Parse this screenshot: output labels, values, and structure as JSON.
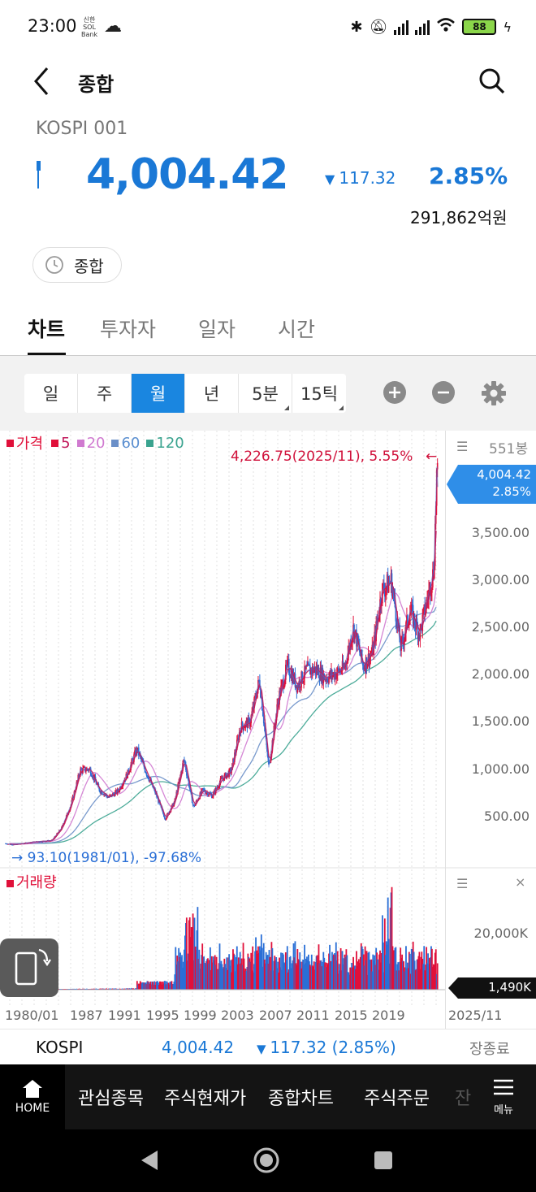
{
  "status_bar": {
    "time": "23:00",
    "bank_mark": "신한 SOL Bank",
    "battery": "88"
  },
  "header": {
    "title": "종합"
  },
  "quote": {
    "code": "KOSPI 001",
    "price": "4,004.42",
    "change": "117.32",
    "change_pct": "2.85%",
    "trade_amount": "291,862억원",
    "market": "종합"
  },
  "tabs": [
    "차트",
    "투자자",
    "일자",
    "시간"
  ],
  "period_buttons": [
    "일",
    "주",
    "월",
    "년",
    "5분",
    "15틱"
  ],
  "selected_period": "월",
  "price_legend": {
    "price": "가격",
    "ma5": "5",
    "ma20": "20",
    "ma60": "60",
    "ma120": "120"
  },
  "bars_count": "551봉",
  "volume_legend": "거래량",
  "annotations": {
    "high": "4,226.75(2025/11), 5.55%",
    "low": "93.10(1981/01), -97.68%"
  },
  "current_tag": {
    "price": "4,004.42",
    "pct": "2.85%"
  },
  "volume_tag": "1,490K",
  "y_ticks": [
    "3,500.00",
    "3,000.00",
    "2,500.00",
    "2,000.00",
    "1,500.00",
    "1,000.00",
    "500.00"
  ],
  "volume_ticks": [
    "20,000K"
  ],
  "x_ticks": [
    "1980/01",
    "1987",
    "1991",
    "1995",
    "1999",
    "2003",
    "2007",
    "2011",
    "2015",
    "2019"
  ],
  "x_last": "2025/11",
  "colors": {
    "up": "#e0103a",
    "down": "#2a6fd6",
    "ma5": "#c2185b",
    "ma20": "#d07ad0",
    "ma60": "#6a8fc8",
    "ma120": "#3aa38f",
    "accent": "#1a78d6"
  },
  "chart_data": {
    "type": "line",
    "title": "",
    "x": [
      1980,
      1981,
      1983,
      1985,
      1986,
      1987,
      1988,
      1989,
      1990,
      1991,
      1992,
      1993,
      1994,
      1995,
      1996,
      1997,
      1998,
      1999,
      2000,
      2001,
      2002,
      2003,
      2004,
      2005,
      2006,
      2007,
      2008,
      2009,
      2010,
      2011,
      2012,
      2013,
      2014,
      2015,
      2016,
      2017,
      2018,
      2019,
      2020,
      2021,
      2022,
      2023,
      2024,
      2025.5,
      2025.83,
      2025.92
    ],
    "series": [
      {
        "name": "가격",
        "values": [
          106,
          93,
          122,
          139,
          272,
          525,
          907,
          919,
          696,
          610,
          678,
          866,
          1138,
          882,
          651,
          376,
          562,
          1028,
          504,
          693,
          627,
          810,
          896,
          1379,
          1434,
          1897,
          938,
          1683,
          2051,
          1826,
          1997,
          2011,
          1916,
          1961,
          2026,
          2467,
          2041,
          2197,
          2873,
          2977,
          2236,
          2655,
          2399,
          3100,
          4226,
          4004
        ]
      }
    ],
    "ylim": [
      0,
      4300
    ],
    "volume_unit": "K",
    "volume_max_label": "20,000K",
    "last_volume": "1,490K",
    "high_point": {
      "x": "2025/11",
      "value": 4226.75,
      "pct": "5.55%"
    },
    "low_point": {
      "x": "1981/01",
      "value": 93.1,
      "pct": "-97.68%"
    }
  },
  "bottom_ticker": {
    "name": "KOSPI",
    "price": "4,004.42",
    "change": "117.32 (2.85%)",
    "status": "장종료"
  },
  "nav": {
    "home": "HOME",
    "items": [
      "관심종목",
      "주식현재가",
      "종합차트",
      "주식주문",
      "잔"
    ],
    "menu": "메뉴"
  }
}
